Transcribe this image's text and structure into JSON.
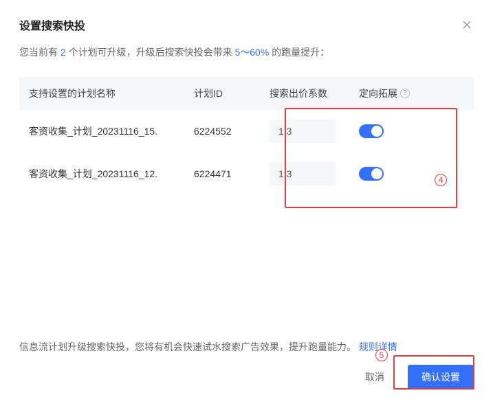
{
  "modal": {
    "title": "设置搜索快投",
    "subtitle_prefix": "您当前有 ",
    "subtitle_count": "2",
    "subtitle_mid": " 个计划可升级，升级后搜索快投会带来 ",
    "subtitle_range": "5～60%",
    "subtitle_suffix": " 的跑量提升："
  },
  "table": {
    "headers": {
      "name": "支持设置的计划名称",
      "id": "计划ID",
      "coef": "搜索出价系数",
      "ext": "定向拓展"
    },
    "rows": [
      {
        "name": "客资收集_计划_20231116_15.",
        "id": "6224552",
        "coef": "1.3",
        "ext_on": true
      },
      {
        "name": "客资收集_计划_20231116_12.",
        "id": "6224471",
        "coef": "1.3",
        "ext_on": true
      }
    ]
  },
  "footer": {
    "note": "信息流计划升级搜索快投，您将有机会快速试水搜索广告效果，提升跑量能力。",
    "link": "规则详情",
    "cancel": "取消",
    "confirm": "确认设置"
  },
  "annotations": {
    "box4": "4",
    "box5": "5"
  }
}
